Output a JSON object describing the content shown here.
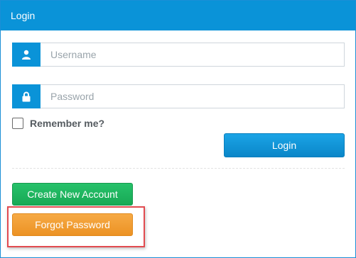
{
  "panel": {
    "title": "Login"
  },
  "form": {
    "username_placeholder": "Username",
    "username_value": "",
    "username_icon": "user-icon",
    "password_placeholder": "Password",
    "password_value": "",
    "password_icon": "lock-icon",
    "remember_label": "Remember me?",
    "remember_checked": false,
    "login_label": "Login"
  },
  "actions": {
    "create_label": "Create New Account",
    "forgot_label": "Forgot Password"
  },
  "colors": {
    "primary": "#0a93d8",
    "success": "#18a955",
    "warning": "#ec9224",
    "highlight": "#e24b50"
  }
}
